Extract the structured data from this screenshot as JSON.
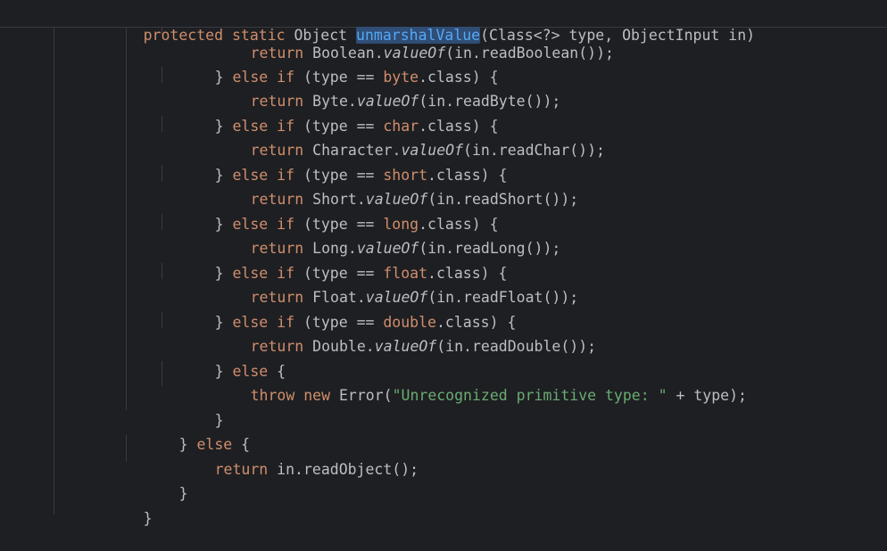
{
  "header": {
    "kw1": "protected",
    "kw2": "static",
    "type": "Object",
    "method": "unmarshalValue",
    "params": "(Class<?> type, ObjectInput in)"
  },
  "lines": {
    "l0": {
      "kw": "return",
      "a": "Boolean.",
      "it": "valueOf",
      "b": "(in.readBoolean());"
    },
    "l1": {
      "brace": "} ",
      "kw1": "else if",
      "a": " (type == ",
      "kw2": "byte",
      "b": ".class) {"
    },
    "l2": {
      "kw": "return",
      "a": "Byte.",
      "it": "valueOf",
      "b": "(in.readByte());"
    },
    "l3": {
      "brace": "} ",
      "kw1": "else if",
      "a": " (type == ",
      "kw2": "char",
      "b": ".class) {"
    },
    "l4": {
      "kw": "return",
      "a": "Character.",
      "it": "valueOf",
      "b": "(in.readChar());"
    },
    "l5": {
      "brace": "} ",
      "kw1": "else if",
      "a": " (type == ",
      "kw2": "short",
      "b": ".class) {"
    },
    "l6": {
      "kw": "return",
      "a": "Short.",
      "it": "valueOf",
      "b": "(in.readShort());"
    },
    "l7": {
      "brace": "} ",
      "kw1": "else if",
      "a": " (type == ",
      "kw2": "long",
      "b": ".class) {"
    },
    "l8": {
      "kw": "return",
      "a": "Long.",
      "it": "valueOf",
      "b": "(in.readLong());"
    },
    "l9": {
      "brace": "} ",
      "kw1": "else if",
      "a": " (type == ",
      "kw2": "float",
      "b": ".class) {"
    },
    "l10": {
      "kw": "return",
      "a": "Float.",
      "it": "valueOf",
      "b": "(in.readFloat());"
    },
    "l11": {
      "brace": "} ",
      "kw1": "else if",
      "a": " (type == ",
      "kw2": "double",
      "b": ".class) {"
    },
    "l12": {
      "kw": "return",
      "a": "Double.",
      "it": "valueOf",
      "b": "(in.readDouble());"
    },
    "l13": {
      "brace": "} ",
      "kw1": "else",
      "a": " {"
    },
    "l14": {
      "kw1": "throw",
      "kw2": "new",
      "a": " Error(",
      "str": "\"Unrecognized primitive type: \"",
      "b": " + type);"
    },
    "l15": {
      "brace": "}"
    },
    "l16": {
      "brace": "} ",
      "kw1": "else",
      "a": " {"
    },
    "l17": {
      "kw": "return",
      "a": " in.readObject();"
    },
    "l18": {
      "brace": "}"
    },
    "l19": {
      "brace": "}"
    }
  },
  "colors": {
    "background": "#1e1f22",
    "keyword": "#cf8e6d",
    "string": "#6aab73",
    "method_declaration": "#56a8f5",
    "text": "#bcbec4"
  }
}
